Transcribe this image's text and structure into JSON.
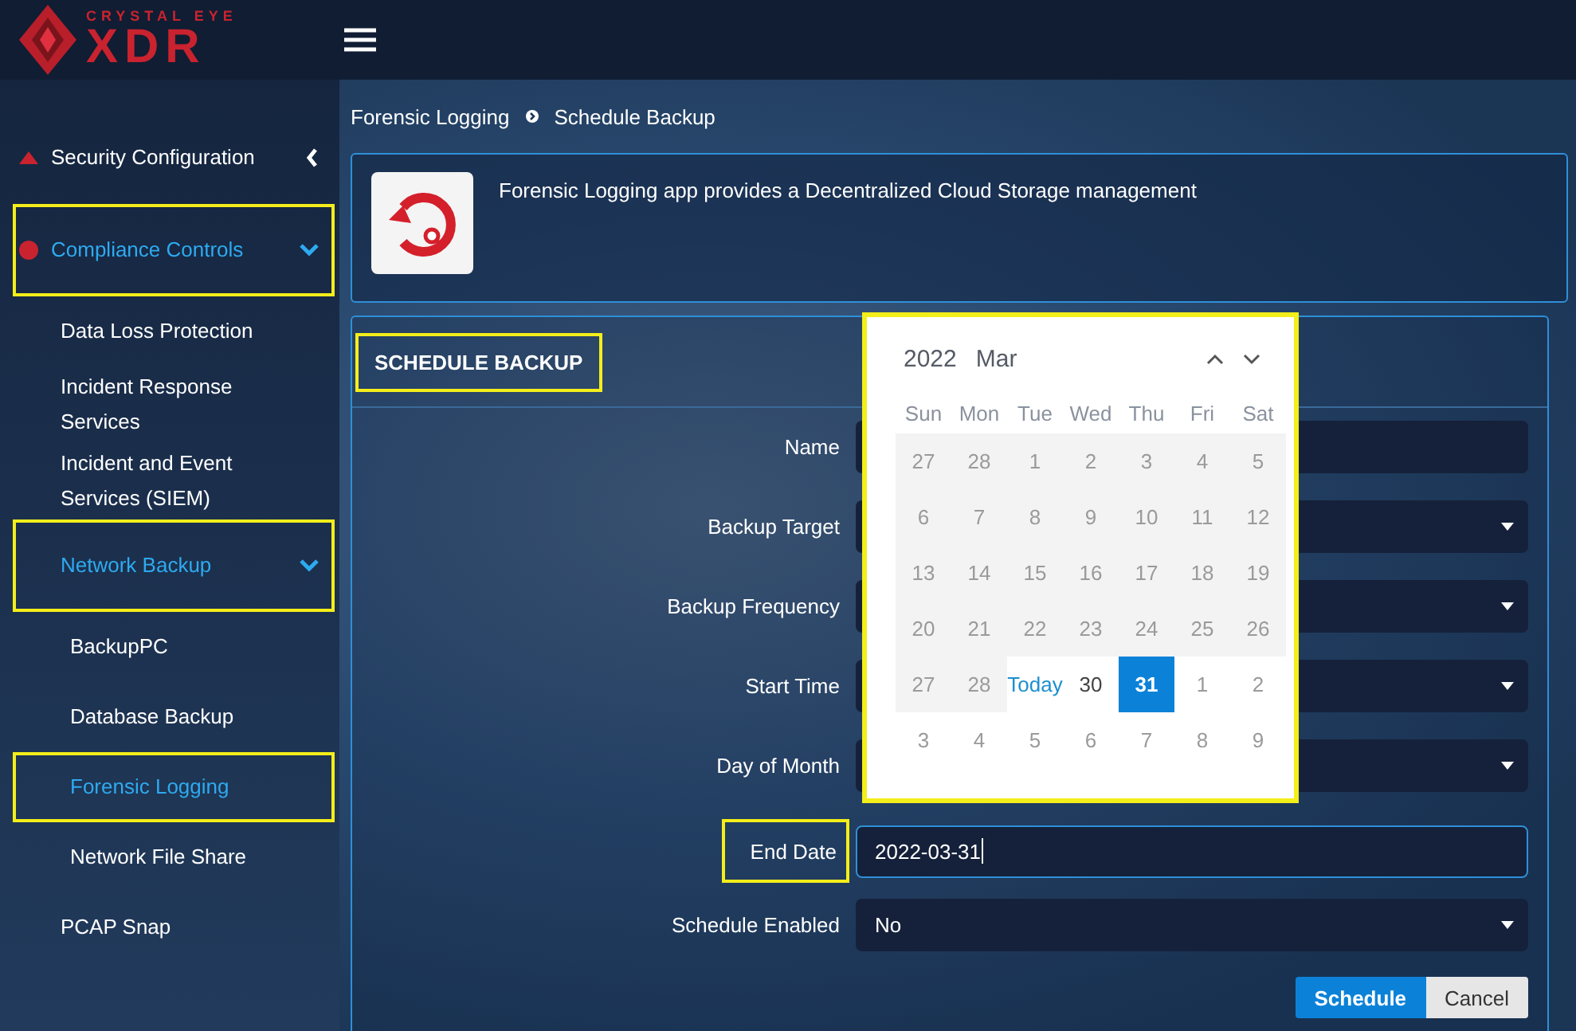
{
  "logo": {
    "tagline": "CRYSTAL EYE",
    "wordmark": "XDR"
  },
  "sidebar": {
    "items": [
      {
        "label": "Security Configuration",
        "kind": "section",
        "expanded": false,
        "selected": false,
        "highlighted": false
      },
      {
        "label": "Compliance Controls",
        "kind": "section",
        "expanded": true,
        "selected": true,
        "highlighted": true
      },
      {
        "label": "Data Loss Protection",
        "kind": "item",
        "selected": false,
        "highlighted": false
      },
      {
        "label": "Incident Response Services",
        "kind": "item",
        "selected": false,
        "highlighted": false
      },
      {
        "label": "Incident and Event Services (SIEM)",
        "kind": "item",
        "selected": false,
        "highlighted": false
      },
      {
        "label": "Network Backup",
        "kind": "group",
        "expanded": true,
        "selected": true,
        "highlighted": true
      },
      {
        "label": "BackupPC",
        "kind": "subitem",
        "selected": false,
        "highlighted": false
      },
      {
        "label": "Database Backup",
        "kind": "subitem",
        "selected": false,
        "highlighted": false
      },
      {
        "label": "Forensic Logging",
        "kind": "subitem",
        "selected": true,
        "highlighted": true
      },
      {
        "label": "Network File Share",
        "kind": "subitem",
        "selected": false,
        "highlighted": false
      },
      {
        "label": "PCAP Snap",
        "kind": "item",
        "selected": false,
        "highlighted": false
      }
    ]
  },
  "breadcrumb": [
    "Forensic Logging",
    "Schedule Backup"
  ],
  "app_info": {
    "description": "Forensic Logging app provides a Decentralized Cloud Storage management"
  },
  "form": {
    "title": "SCHEDULE BACKUP",
    "title_highlighted": true,
    "fields": [
      {
        "label": "Name",
        "kind": "text",
        "focused": false,
        "highlighted": false
      },
      {
        "label": "Backup Target",
        "kind": "select",
        "focused": false,
        "highlighted": false
      },
      {
        "label": "Backup Frequency",
        "kind": "select",
        "focused": false,
        "highlighted": false
      },
      {
        "label": "Start Time",
        "kind": "select",
        "focused": false,
        "highlighted": false
      },
      {
        "label": "Day of Month",
        "kind": "select",
        "focused": false,
        "highlighted": false
      },
      {
        "label": "End Date",
        "kind": "text",
        "value": "2022-03-31",
        "focused": true,
        "highlighted": true
      },
      {
        "label": "Schedule Enabled",
        "kind": "select",
        "value": "No",
        "focused": false,
        "highlighted": false
      }
    ],
    "buttons": [
      {
        "label": "Schedule",
        "kind": "primary"
      },
      {
        "label": "Cancel",
        "kind": "secondary"
      }
    ]
  },
  "calendar": {
    "year": "2022",
    "month": "Mar",
    "highlighted": true,
    "weekdays": [
      "Sun",
      "Mon",
      "Tue",
      "Wed",
      "Thu",
      "Fri",
      "Sat"
    ],
    "days": [
      {
        "label": "27",
        "kind": "disabled",
        "selected": false
      },
      {
        "label": "28",
        "kind": "disabled",
        "selected": false
      },
      {
        "label": "1",
        "kind": "disabled",
        "selected": false
      },
      {
        "label": "2",
        "kind": "disabled",
        "selected": false
      },
      {
        "label": "3",
        "kind": "disabled",
        "selected": false
      },
      {
        "label": "4",
        "kind": "disabled",
        "selected": false
      },
      {
        "label": "5",
        "kind": "disabled",
        "selected": false
      },
      {
        "label": "6",
        "kind": "disabled",
        "selected": false
      },
      {
        "label": "7",
        "kind": "disabled",
        "selected": false
      },
      {
        "label": "8",
        "kind": "disabled",
        "selected": false
      },
      {
        "label": "9",
        "kind": "disabled",
        "selected": false
      },
      {
        "label": "10",
        "kind": "disabled",
        "selected": false
      },
      {
        "label": "11",
        "kind": "disabled",
        "selected": false
      },
      {
        "label": "12",
        "kind": "disabled",
        "selected": false
      },
      {
        "label": "13",
        "kind": "disabled",
        "selected": false
      },
      {
        "label": "14",
        "kind": "disabled",
        "selected": false
      },
      {
        "label": "15",
        "kind": "disabled",
        "selected": false
      },
      {
        "label": "16",
        "kind": "disabled",
        "selected": false
      },
      {
        "label": "17",
        "kind": "disabled",
        "selected": false
      },
      {
        "label": "18",
        "kind": "disabled",
        "selected": false
      },
      {
        "label": "19",
        "kind": "disabled",
        "selected": false
      },
      {
        "label": "20",
        "kind": "disabled",
        "selected": false
      },
      {
        "label": "21",
        "kind": "disabled",
        "selected": false
      },
      {
        "label": "22",
        "kind": "disabled",
        "selected": false
      },
      {
        "label": "23",
        "kind": "disabled",
        "selected": false
      },
      {
        "label": "24",
        "kind": "disabled",
        "selected": false
      },
      {
        "label": "25",
        "kind": "disabled",
        "selected": false
      },
      {
        "label": "26",
        "kind": "disabled",
        "selected": false
      },
      {
        "label": "27",
        "kind": "disabled",
        "selected": false
      },
      {
        "label": "28",
        "kind": "disabled",
        "selected": false
      },
      {
        "label": "Today",
        "kind": "today",
        "selected": false
      },
      {
        "label": "30",
        "kind": "normal",
        "selected": false
      },
      {
        "label": "31",
        "kind": "normal",
        "selected": true
      },
      {
        "label": "1",
        "kind": "other",
        "selected": false
      },
      {
        "label": "2",
        "kind": "other",
        "selected": false
      },
      {
        "label": "3",
        "kind": "other",
        "selected": false
      },
      {
        "label": "4",
        "kind": "other",
        "selected": false
      },
      {
        "label": "5",
        "kind": "other",
        "selected": false
      },
      {
        "label": "6",
        "kind": "other",
        "selected": false
      },
      {
        "label": "7",
        "kind": "other",
        "selected": false
      },
      {
        "label": "8",
        "kind": "other",
        "selected": false
      },
      {
        "label": "9",
        "kind": "other",
        "selected": false
      }
    ]
  }
}
